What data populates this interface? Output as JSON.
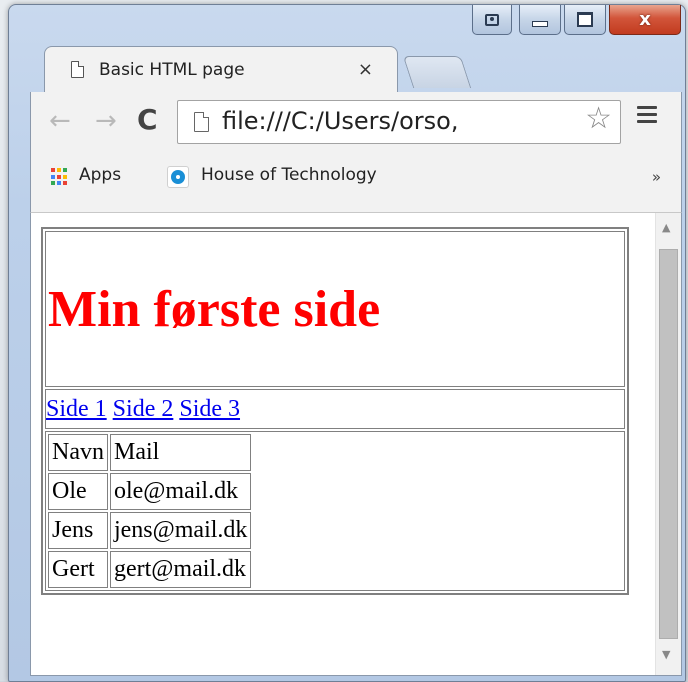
{
  "window": {
    "caption_close": "x"
  },
  "tab": {
    "title": "Basic HTML page",
    "close_label": "×"
  },
  "toolbar": {
    "back_label": "←",
    "forward_label": "→",
    "reload_label": "C",
    "url": "file:///C:/Users/orso,",
    "star_label": "☆"
  },
  "bookmarks": {
    "items": [
      {
        "label": "Apps"
      },
      {
        "label": "House of Technology"
      }
    ],
    "more_label": "»"
  },
  "page": {
    "heading": "Min første side",
    "heading_color": "#ff0000",
    "nav_links": [
      "Side 1",
      "Side 2",
      "Side 3"
    ],
    "link_color": "#0000ee",
    "table": {
      "header": [
        "Navn",
        "Mail"
      ],
      "rows": [
        [
          "Ole",
          "ole@mail.dk"
        ],
        [
          "Jens",
          "jens@mail.dk"
        ],
        [
          "Gert",
          "gert@mail.dk"
        ]
      ]
    }
  },
  "scrollbar": {
    "up_label": "▲",
    "down_label": "▼"
  }
}
